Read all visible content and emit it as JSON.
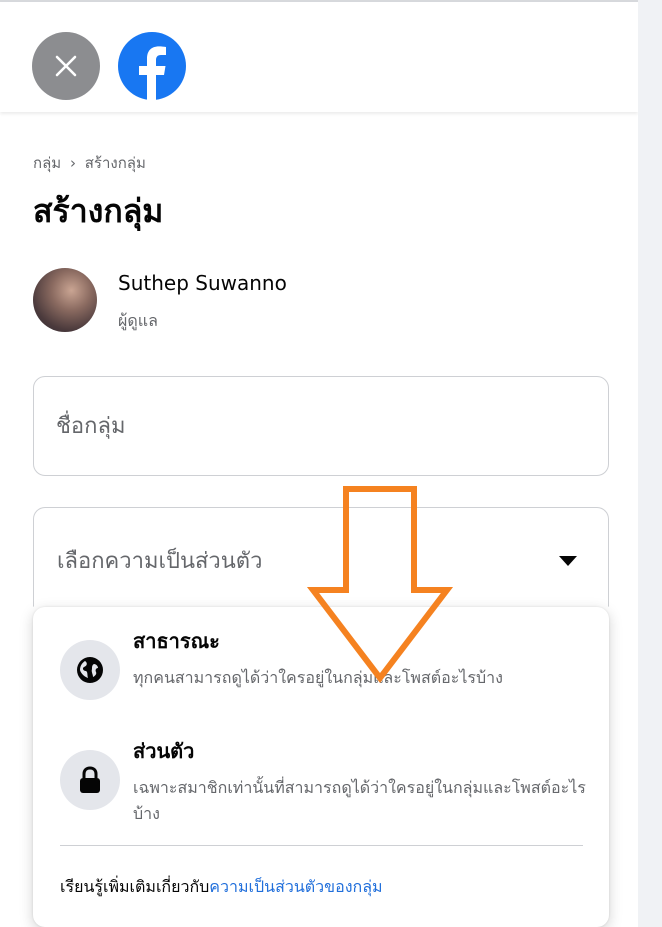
{
  "header": {
    "close_icon": "close-icon",
    "logo": "facebook-logo"
  },
  "breadcrumb": {
    "groups": "กลุ่ม",
    "separator": "›",
    "create": "สร้างกลุ่ม"
  },
  "page_title": "สร้างกลุ่ม",
  "user": {
    "name": "Suthep Suwanno",
    "role": "ผู้ดูแล"
  },
  "form": {
    "group_name_placeholder": "ชื่อกลุ่ม",
    "privacy_placeholder": "เลือกความเป็นส่วนตัว"
  },
  "privacy_options": [
    {
      "title": "สาธารณะ",
      "desc": "ทุกคนสามารถดูได้ว่าใครอยู่ในกลุ่มและโพสต์อะไรบ้าง",
      "icon": "globe-icon"
    },
    {
      "title": "ส่วนตัว",
      "desc": "เฉพาะสมาชิกเท่านั้นที่สามารถดูได้ว่าใครอยู่ในกลุ่มและโพสต์อะไรบ้าง",
      "icon": "lock-icon"
    }
  ],
  "learn_more": {
    "prefix": "เรียนรู้เพิ่มเติมเกี่ยวกับ",
    "link": "ความเป็นส่วนตัวของกลุ่ม"
  },
  "colors": {
    "link": "#216fdb",
    "annotation_arrow": "#f58220"
  }
}
